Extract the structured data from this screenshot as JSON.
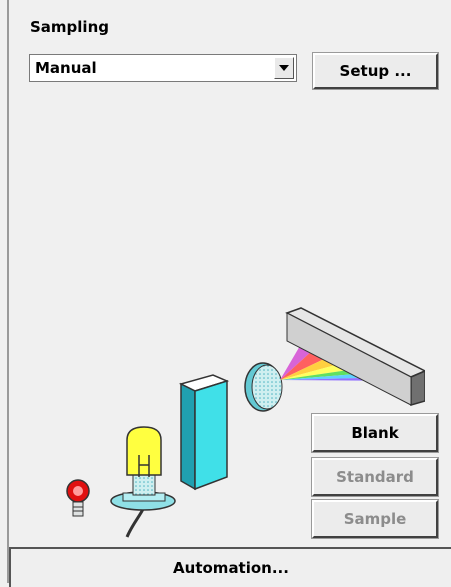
{
  "sampling": {
    "title": "Sampling",
    "mode_value": "Manual",
    "setup_label": "Setup ..."
  },
  "actions": {
    "blank_label": "Blank",
    "standard_label": "Standard",
    "sample_label": "Sample",
    "automation_label": "Automation..."
  },
  "icons": {
    "dropdown": "chevron-down-icon",
    "illustration": "spectrometer-illustration"
  }
}
